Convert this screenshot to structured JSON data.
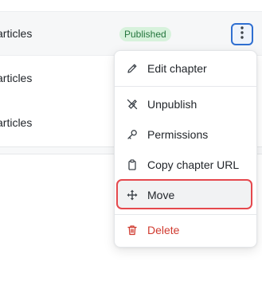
{
  "table": {
    "rows": [
      {
        "name": "articles",
        "status": "Published"
      },
      {
        "name": "articles",
        "status": ""
      },
      {
        "name": "articles",
        "status": ""
      }
    ]
  },
  "actions_button": {
    "icon": "kebab-vertical-icon"
  },
  "menu": {
    "items": [
      {
        "label": "Edit chapter",
        "icon": "pencil-icon"
      },
      {
        "label": "Unpublish",
        "icon": "unpublish-icon"
      },
      {
        "label": "Permissions",
        "icon": "key-icon"
      },
      {
        "label": "Copy chapter URL",
        "icon": "clipboard-icon"
      },
      {
        "label": "Move",
        "icon": "move-arrows-icon",
        "highlighted": true
      },
      {
        "label": "Delete",
        "icon": "trash-icon",
        "danger": true
      }
    ]
  },
  "colors": {
    "badge_bg": "#d7f2dc",
    "badge_text": "#24753d",
    "highlight_border": "#e5484d",
    "danger": "#d03a2f",
    "focus_blue": "#2f6fd1"
  }
}
